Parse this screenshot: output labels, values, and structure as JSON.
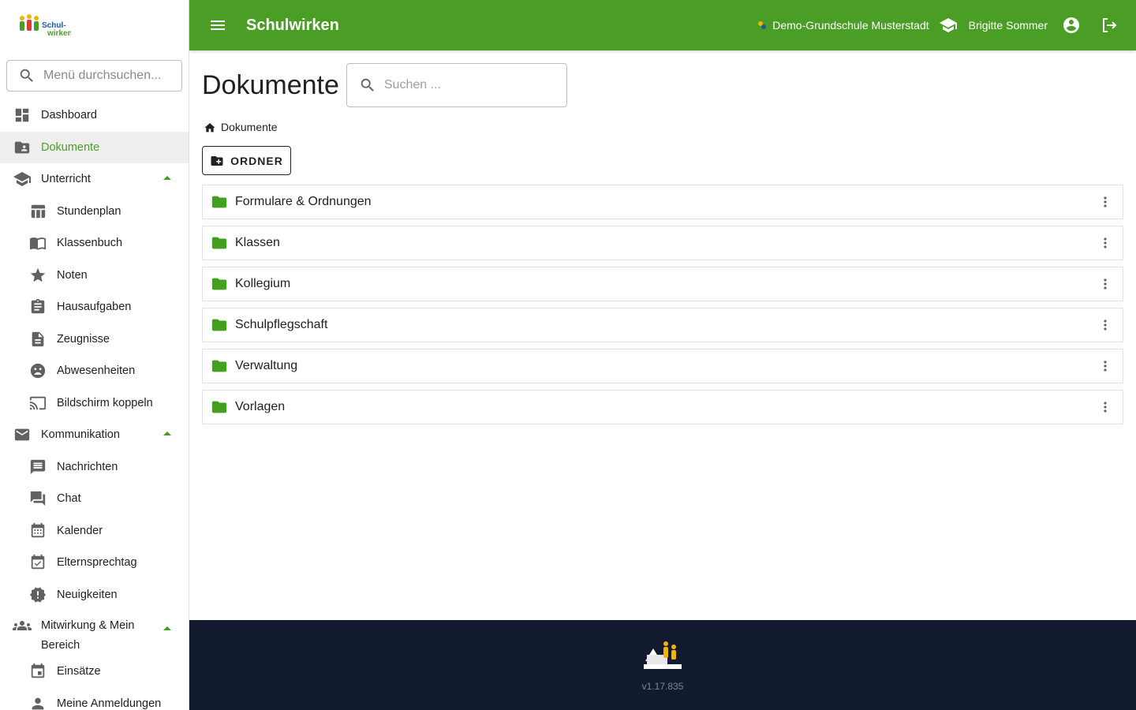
{
  "app": {
    "title": "Schulwirken"
  },
  "header": {
    "school": "Demo-Grundschule Musterstadt",
    "user": "Brigitte Sommer"
  },
  "sidebar": {
    "search_placeholder": "Menü durchsuchen...",
    "items": [
      {
        "label": "Dashboard",
        "icon": "dashboard-icon"
      },
      {
        "label": "Dokumente",
        "icon": "folder-shared-icon",
        "active": true
      },
      {
        "label": "Unterricht",
        "icon": "school-icon",
        "group": true
      },
      {
        "label": "Stundenplan",
        "icon": "table-icon"
      },
      {
        "label": "Klassenbuch",
        "icon": "book-icon"
      },
      {
        "label": "Noten",
        "icon": "star-icon"
      },
      {
        "label": "Hausaufgaben",
        "icon": "assignment-icon"
      },
      {
        "label": "Zeugnisse",
        "icon": "description-icon"
      },
      {
        "label": "Abwesenheiten",
        "icon": "sad-face-icon"
      },
      {
        "label": "Bildschirm koppeln",
        "icon": "cast-icon"
      },
      {
        "label": "Kommunikation",
        "icon": "mail-icon",
        "group": true
      },
      {
        "label": "Nachrichten",
        "icon": "message-icon"
      },
      {
        "label": "Chat",
        "icon": "forum-icon"
      },
      {
        "label": "Kalender",
        "icon": "calendar-icon"
      },
      {
        "label": "Elternsprechtag",
        "icon": "event-available-icon"
      },
      {
        "label": "Neuigkeiten",
        "icon": "new-releases-icon"
      },
      {
        "label": "Mitwirkung & Mein Bereich",
        "icon": "groups-icon",
        "group": true
      },
      {
        "label": "Einsätze",
        "icon": "event-icon"
      },
      {
        "label": "Meine Anmeldungen",
        "icon": "person-icon"
      }
    ]
  },
  "main": {
    "title": "Dokumente",
    "search_placeholder": "Suchen ...",
    "breadcrumb": "Dokumente",
    "new_folder_label": "ORDNER",
    "folders": [
      "Formulare & Ordnungen",
      "Klassen",
      "Kollegium",
      "Schulpflegschaft",
      "Verwaltung",
      "Vorlagen"
    ]
  },
  "footer": {
    "version": "v1.17.835"
  },
  "colors": {
    "brand": "#4a9e26",
    "footer": "#111a2e",
    "folder": "#43a01f"
  }
}
